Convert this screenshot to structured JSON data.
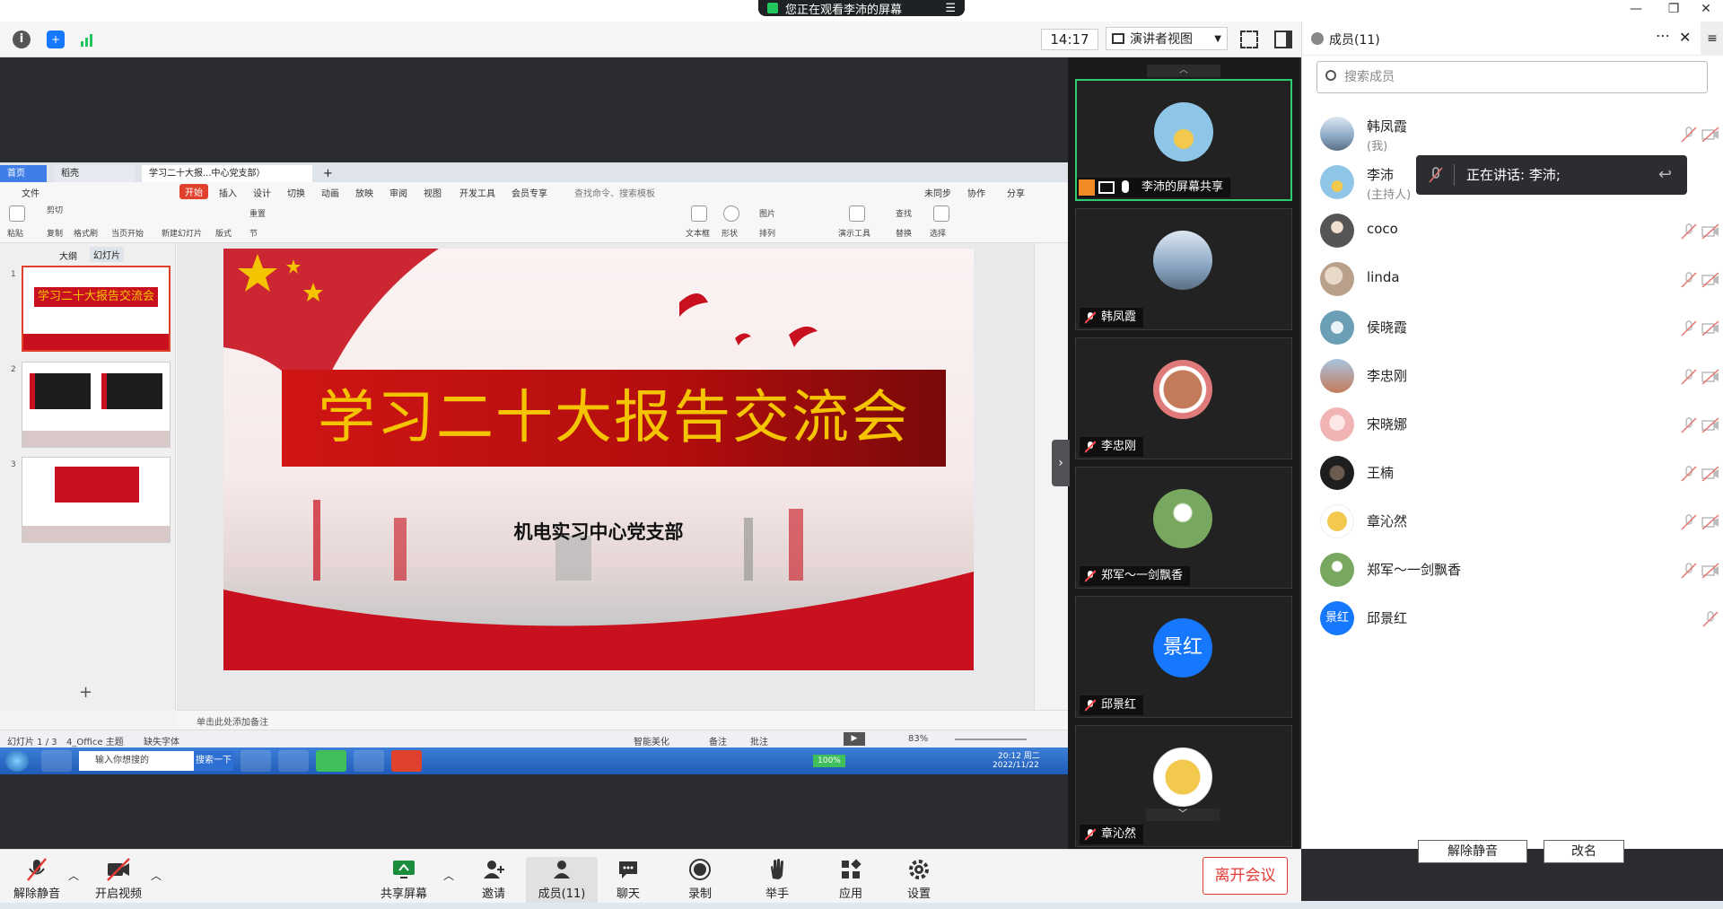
{
  "titlebar": {
    "share_notice": "您正在观看李沛的屏幕"
  },
  "toolbar": {
    "time": "14:17",
    "view_mode": "演讲者视图"
  },
  "wps": {
    "tab_home": "首页",
    "tab_shell": "稻壳",
    "tab_doc": "学习二十大报...中心党支部）",
    "menu": [
      "文件",
      "开始",
      "插入",
      "设计",
      "切换",
      "动画",
      "放映",
      "审阅",
      "视图",
      "开发工具",
      "会员专享"
    ],
    "search_placeholder": "查找命令、搜索模板",
    "menu_right": [
      "未同步",
      "协作",
      "分享"
    ],
    "ribbon": [
      "粘贴",
      "剪切",
      "复制",
      "格式刷",
      "当页开始",
      "新建幻灯片",
      "版式",
      "节",
      "重置",
      "文本框",
      "形状",
      "图片",
      "排列",
      "演示工具",
      "查找",
      "替换",
      "选择"
    ],
    "outline_tab": "大纲",
    "slides_tab": "幻灯片",
    "slide_numbers": [
      "1",
      "2",
      "3"
    ],
    "slide_title": "学习二十大报告交流会",
    "slide_subtitle": "机电实习中心党支部",
    "notes_placeholder": "单击此处添加备注",
    "status_slide": "幻灯片 1 / 3",
    "status_theme": "4_Office 主题",
    "status_font": "缺失字体",
    "status_beautify": "智能美化",
    "status_notes": "备注",
    "status_comments": "批注",
    "zoom": "83%",
    "taskbar_input": "输入你想搜的",
    "taskbar_search": "搜索一下",
    "taskbar_battery": "100%",
    "taskbar_time": "20:12 周二",
    "taskbar_date": "2022/11/22"
  },
  "video_tiles": [
    {
      "name": "李沛的屏幕共享",
      "color": "#8fc6e8",
      "active": true
    },
    {
      "name": "韩凤霞",
      "color": "#8aa6c2",
      "active": false
    },
    {
      "name": "李忠刚",
      "color": "#c47b5b",
      "active": false
    },
    {
      "name": "郑军～一剑飘香",
      "color": "#78a860",
      "active": false
    },
    {
      "name": "邱景红",
      "avatar_text": "景红",
      "color": "#1677ff",
      "active": false
    },
    {
      "name": "章沁然",
      "color": "#f2c94c",
      "active": false
    }
  ],
  "panel": {
    "title": "成员(11)",
    "search_placeholder": "搜索成员",
    "speaking_label": "正在讲话: 李沛;",
    "unmute_all": "解除静音",
    "rename": "改名",
    "members": [
      {
        "name": "韩凤霞",
        "sub": "(我)",
        "color": "#8aa6c2"
      },
      {
        "name": "李沛",
        "sub": "(主持人)",
        "color": "#8fc6e8"
      },
      {
        "name": "coco",
        "sub": "",
        "color": "#8b8b8b"
      },
      {
        "name": "linda",
        "sub": "",
        "color": "#b9a08a"
      },
      {
        "name": "侯晓霞",
        "sub": "",
        "color": "#6a9fb5"
      },
      {
        "name": "李忠刚",
        "sub": "",
        "color": "#c47b5b"
      },
      {
        "name": "宋晓娜",
        "sub": "",
        "color": "#f1b4b4"
      },
      {
        "name": "王楠",
        "sub": "",
        "color": "#2e2e2e"
      },
      {
        "name": "章沁然",
        "sub": "",
        "color": "#f2c94c"
      },
      {
        "name": "郑军～一剑飘香",
        "sub": "",
        "color": "#78a860"
      },
      {
        "name": "邱景红",
        "sub": "",
        "avatar_text": "景红",
        "color": "#1677ff"
      }
    ]
  },
  "controls": {
    "unmute": "解除静音",
    "start_video": "开启视频",
    "share_screen": "共享屏幕",
    "invite": "邀请",
    "members": "成员(11)",
    "chat": "聊天",
    "record": "录制",
    "raise_hand": "举手",
    "apps": "应用",
    "settings": "设置",
    "leave": "离开会议"
  },
  "colors": {
    "accent": "#1677ff",
    "danger": "#e53935",
    "active_border": "#2ecc71",
    "slide_red": "#c8101e",
    "slide_gold": "#f5c400"
  }
}
